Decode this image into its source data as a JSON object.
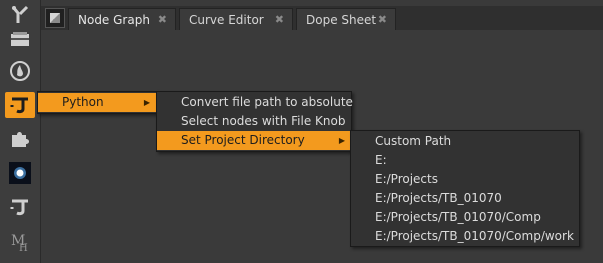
{
  "toolbar": {
    "tools": [
      {
        "icon": "transform-icon"
      },
      {
        "icon": "folder-icon"
      },
      {
        "icon": "flame-icon"
      },
      {
        "icon": "python-icon",
        "active": true
      },
      {
        "icon": "puzzle-icon"
      },
      {
        "icon": "glow-icon"
      },
      {
        "icon": "python-icon"
      },
      {
        "icon": "mh-icon"
      }
    ]
  },
  "tabs": [
    {
      "label": "Node Graph",
      "active": true
    },
    {
      "label": "Curve Editor"
    },
    {
      "label": "Dope Sheet"
    }
  ],
  "menu_python": {
    "label": "Python"
  },
  "submenu_python": {
    "items": [
      {
        "label": "Convert file path to absolute"
      },
      {
        "label": "Select nodes with File Knob"
      },
      {
        "label": "Set Project Directory"
      }
    ]
  },
  "submenu_project_dir": {
    "items": [
      {
        "label": "Custom Path"
      },
      {
        "label": "E:"
      },
      {
        "label": "E:/Projects"
      },
      {
        "label": "E:/Projects/TB_01070"
      },
      {
        "label": "E:/Projects/TB_01070/Comp"
      },
      {
        "label": "E:/Projects/TB_01070/Comp/work"
      }
    ]
  },
  "colors": {
    "accent": "#f39a1e",
    "panel": "#3a3a3a",
    "menu": "#323232"
  }
}
